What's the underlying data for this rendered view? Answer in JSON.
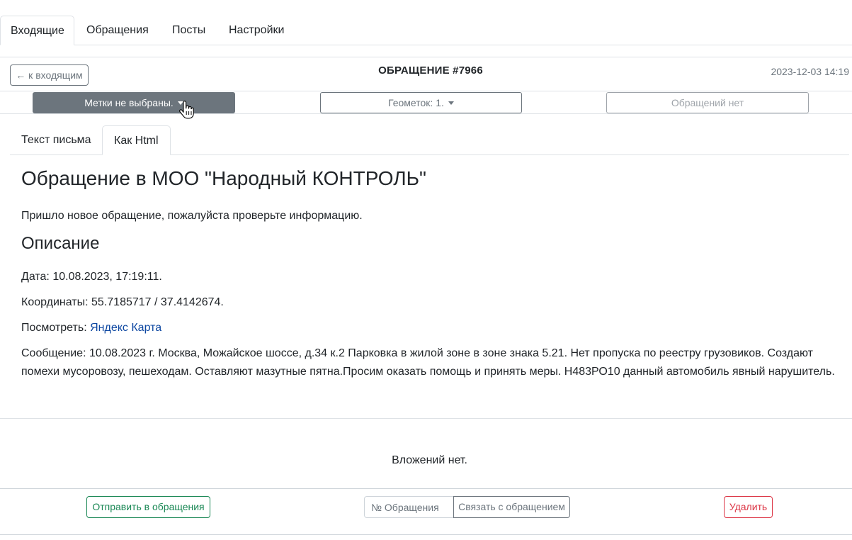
{
  "nav": {
    "tabs": [
      {
        "label": "Входящие",
        "active": true
      },
      {
        "label": "Обращения",
        "active": false
      },
      {
        "label": "Посты",
        "active": false
      },
      {
        "label": "Настройки",
        "active": false
      }
    ]
  },
  "header": {
    "back_label": "← к входящим",
    "title": "ОБРАЩЕНИЕ #7966",
    "timestamp": "2023-12-03 14:19"
  },
  "controls": {
    "tags_label": "Метки не выбраны.",
    "geotags_label": "Геометок: 1.",
    "appeals_label": "Обращений нет"
  },
  "content_tabs": [
    {
      "label": "Текст письма",
      "active": false
    },
    {
      "label": "Как Html",
      "active": true
    }
  ],
  "letter": {
    "heading": "Обращение в МОО \"Народный КОНТРОЛЬ\"",
    "intro": "Пришло новое обращение, пожалуйста проверьте информацию.",
    "section_title": "Описание",
    "date_line": "Дата: 10.08.2023, 17:19:11.",
    "coords_line": "Координаты: 55.7185717 / 37.4142674.",
    "view_prefix": "Посмотреть: ",
    "view_link": "Яндекс Карта",
    "message": "Сообщение: 10.08.2023 г. Москва, Можайское шоссе, д.34 к.2 Парковка в жилой зоне в зоне знака 5.21. Нет пропуска по реестру грузовиков. Создают помехи мусоровозу, пешеходам. Оставляют мазутные пятна.Просим оказать помощь и принять меры. Н483РО10 данный автомобиль явный нарушитель."
  },
  "attachments": {
    "text": "Вложений нет."
  },
  "footer": {
    "send_label": "Отправить в обращения",
    "appeal_number_placeholder": "№ Обращения",
    "link_label": "Связать с обращением",
    "delete_label": "Удалить"
  },
  "colors": {
    "secondary": "#6c757d",
    "success": "#198754",
    "danger": "#dc3545",
    "link": "#0d47a1"
  }
}
